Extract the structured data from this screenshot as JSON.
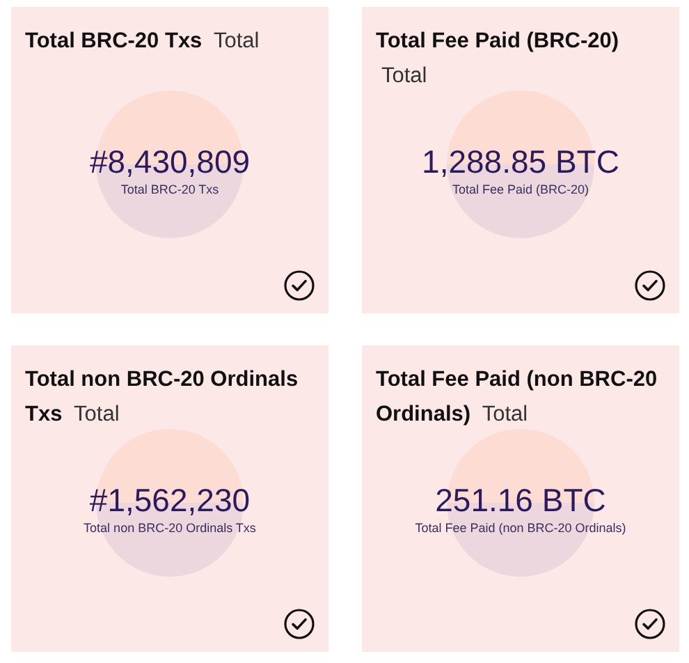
{
  "cards": [
    {
      "title": "Total BRC-20 Txs",
      "suffix": "Total",
      "value": "#8,430,809",
      "caption": "Total BRC-20 Txs",
      "checked": true
    },
    {
      "title": "Total Fee Paid (BRC-20)",
      "suffix": "Total",
      "value": "1,288.85 BTC",
      "caption": "Total Fee Paid (BRC-20)",
      "checked": true
    },
    {
      "title": "Total non BRC-20 Ordinals Txs",
      "suffix": "Total",
      "value": "#1,562,230",
      "caption": "Total non BRC-20 Ordinals Txs",
      "checked": true
    },
    {
      "title": "Total Fee Paid (non BRC-20 Ordinals)",
      "suffix": "Total",
      "value": "251.16 BTC",
      "caption": "Total Fee Paid (non BRC-20 Ordinals)",
      "checked": true
    }
  ]
}
